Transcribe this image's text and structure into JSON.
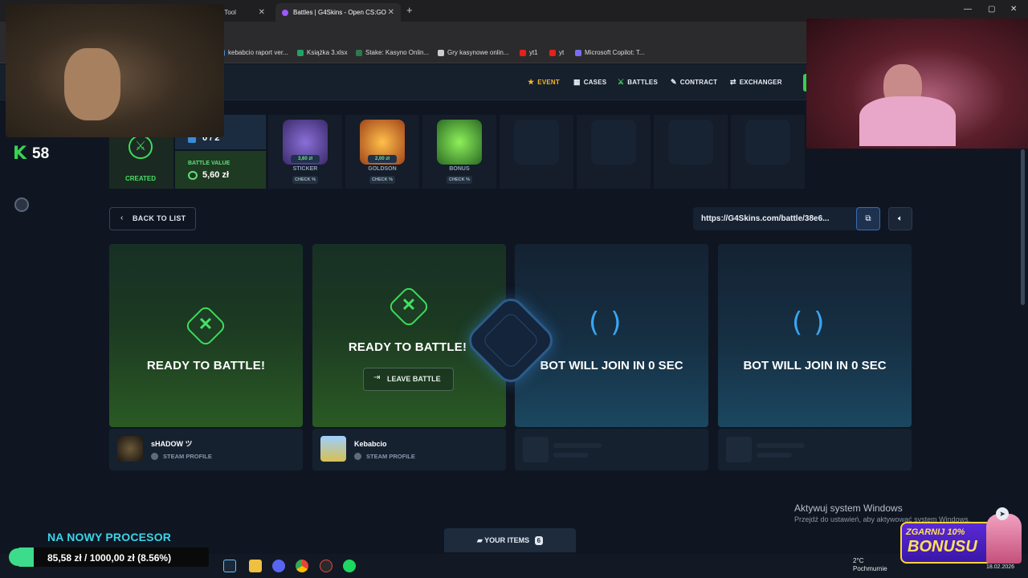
{
  "browser": {
    "tabs": [
      {
        "label": "eaway Tool"
      },
      {
        "label": "Battles | G4Skins - Open CS:GO"
      }
    ],
    "new_tab": "+",
    "window_controls": [
      "—",
      "▢",
      "✕"
    ],
    "bookmarks": [
      {
        "label": "kebabcio raport ver...",
        "color": "#4a8fe0"
      },
      {
        "label": "Książka 3.xlsx",
        "color": "#21a366"
      },
      {
        "label": "Stake: Kasyno Onlin...",
        "color": "#2b7a4b"
      },
      {
        "label": "Gry kasynowe onlin...",
        "color": "#cccccc"
      },
      {
        "label": "yt1",
        "color": "#e62117"
      },
      {
        "label": "yt",
        "color": "#e62117"
      },
      {
        "label": "Microsoft Copilot: T...",
        "color": "#7a6cf0"
      }
    ]
  },
  "nav": {
    "items": [
      {
        "label": "EVENT",
        "icon": "star-icon",
        "glyph": "★",
        "color": "#f5b82e"
      },
      {
        "label": "CASES",
        "icon": "cases-icon",
        "glyph": "▦",
        "color": "#e6edf5"
      },
      {
        "label": "BATTLES",
        "icon": "battles-icon",
        "glyph": "⚔",
        "color": "#46e065"
      },
      {
        "label": "CONTRACT",
        "icon": "pen-icon",
        "glyph": "✎",
        "color": "#e6edf5"
      },
      {
        "label": "EXCHANGER",
        "icon": "exchange-icon",
        "glyph": "⇄",
        "color": "#e6edf5"
      }
    ]
  },
  "sidebar": {
    "logo": "K",
    "count": "58"
  },
  "battle": {
    "status_label": "CREATED",
    "rounds": "0 / 2",
    "value_label": "BATTLE VALUE",
    "value": "5,60 zł",
    "cases": [
      {
        "name": "STICKER",
        "price": "3,60 zł",
        "check": "CHECK %",
        "color": "#6a4fb8"
      },
      {
        "name": "GOLDSON",
        "price": "2,00 zł",
        "check": "CHECK %",
        "color": "#e0952a"
      },
      {
        "name": "BONUS",
        "price": "",
        "check": "CHECK %",
        "color": "#4fcf3d"
      }
    ]
  },
  "controls": {
    "back_label": "BACK TO LIST",
    "battle_url": "https://G4Skins.com/battle/38e6...",
    "leave_label": "LEAVE BATTLE"
  },
  "slots": [
    {
      "status": "READY TO BATTLE!",
      "player": "sHADOW ツ",
      "profile": "STEAM PROFILE"
    },
    {
      "status": "READY TO BATTLE!",
      "player": "Kebabcio",
      "profile": "STEAM PROFILE"
    },
    {
      "status": "BOT WILL JOIN IN 0 SEC"
    },
    {
      "status": "BOT WILL JOIN IN 0 SEC"
    }
  ],
  "your_items": {
    "label": "YOUR ITEMS",
    "count": "6"
  },
  "overlay": {
    "promo_title": "NA NOWY PROCESOR",
    "goal_text": "85,58 zł / 1000,00 zł (8.56%)",
    "goal_progress": 0.0856,
    "bonus_line1": "ZGARNIJ 10%",
    "bonus_line2": "BONUSU"
  },
  "windows": {
    "activate_title": "Aktywuj system Windows",
    "activate_sub": "Przejdź do ustawień, aby aktywować system Windows.",
    "weather_temp": "2°C",
    "weather_desc": "Pochmurnie",
    "date": "18.02.2026"
  }
}
